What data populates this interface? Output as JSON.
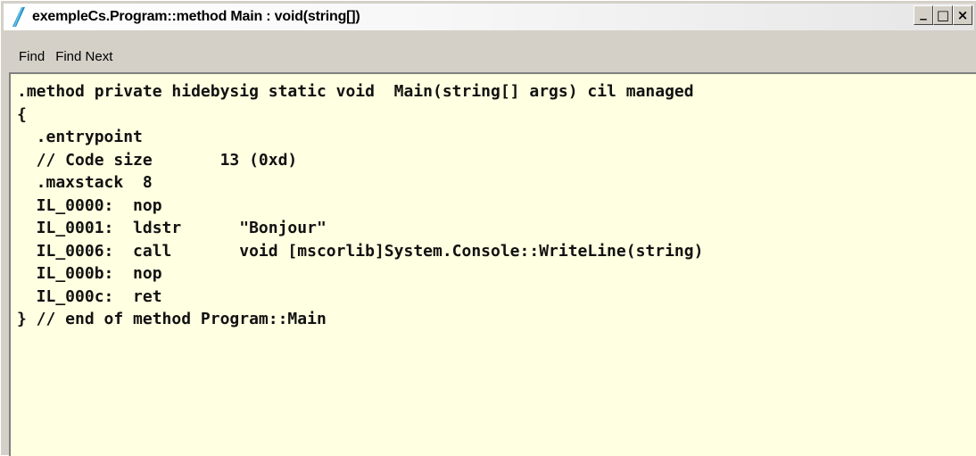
{
  "window": {
    "title": "exempleCs.Program::method Main : void(string[])",
    "controls": {
      "minimize": "_",
      "maximize": "□",
      "close": "×"
    }
  },
  "menu": {
    "items": [
      "Find",
      "Find Next"
    ]
  },
  "code": {
    "lines": [
      ".method private hidebysig static void  Main(string[] args) cil managed",
      "{",
      "  .entrypoint",
      "  // Code size       13 (0xd)",
      "  .maxstack  8",
      "  IL_0000:  nop",
      "  IL_0001:  ldstr      \"Bonjour\"",
      "  IL_0006:  call       void [mscorlib]System.Console::WriteLine(string)",
      "  IL_000b:  nop",
      "  IL_000c:  ret",
      "} // end of method Program::Main"
    ]
  },
  "colors": {
    "editor_background": "#ffffe1",
    "chrome": "#d4d0c8",
    "icon_accent": "#1e88b8"
  },
  "icons": {
    "app": "ildasm-app-icon"
  }
}
